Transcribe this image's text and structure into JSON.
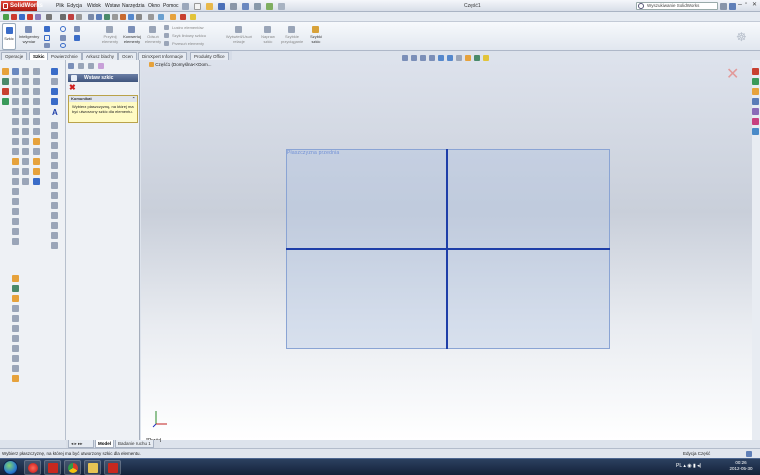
{
  "app": {
    "name": "SolidWorks",
    "document_title": "Część1",
    "search_placeholder": "Wyszukiwanie SolidWorks"
  },
  "menu": [
    "Plik",
    "Edycja",
    "Widok",
    "Wstaw",
    "Narzędzia",
    "Okno",
    "Pomoc"
  ],
  "command_manager": {
    "buttons": [
      {
        "label": "Szkic",
        "icon": "sketch-icon"
      },
      {
        "label": "Inteligentny wymiar",
        "icon": "smart-dimension-icon"
      },
      {
        "label": "Przytnij elementy",
        "icon": "trim-icon"
      },
      {
        "label": "Konwertuj elementy",
        "icon": "convert-entities-icon"
      },
      {
        "label": "Odsuń elementy",
        "icon": "offset-entities-icon"
      },
      {
        "label": "Wyświetl/Usuń relacje",
        "icon": "relations-icon"
      },
      {
        "label": "Napraw szkic",
        "icon": "repair-sketch-icon"
      },
      {
        "label": "Szybkie przyciąganie",
        "icon": "quick-snaps-icon"
      },
      {
        "label": "Szybki szkic",
        "icon": "rapid-sketch-icon"
      }
    ],
    "small_items": [
      "Lustro elementów",
      "Szyk liniowy szkicu",
      "Przesuń elementy"
    ]
  },
  "tabs": [
    "Operacje",
    "Szkic",
    "Powierzchnie",
    "Arkusz blachy",
    "Ocen",
    "DimXpert Informacje",
    "Produkty Office"
  ],
  "active_tab": "Szkic",
  "property_manager": {
    "title": "Wstaw szkic",
    "message_header": "Komunikat",
    "message": "Wybierz płaszczyznę, na której ma być utworzony szkic dla elementu."
  },
  "viewport": {
    "breadcrumb": "Część1 (Domyślna<<Dom...",
    "plane_label": "Płaszczyzna przednia",
    "view_label": "*Przód"
  },
  "bottom_tabs": [
    "Model",
    "Badanie ruchu 1"
  ],
  "active_bottom_tab": "Model",
  "status": {
    "left": "Wybierz płaszczyznę, na której ma być utworzony szkic dla elementu.",
    "right": "Edycja Część"
  },
  "taskbar": {
    "lang": "PL",
    "time": "00:26",
    "date": "2012-05-30"
  },
  "colors": {
    "sketch_line": "#1e3ea8",
    "plane_fill": "#aec4e2",
    "title_red": "#c8281e",
    "message_bg": "#fffbc4"
  }
}
